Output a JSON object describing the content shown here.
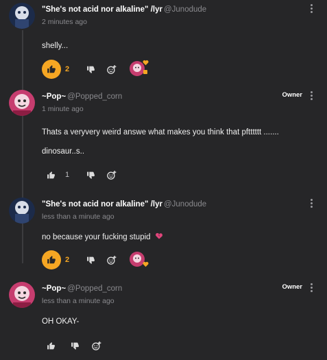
{
  "colors": {
    "background": "#262628",
    "accent": "#f5a623",
    "muted": "#8a8a8e",
    "heart": "#e0457b"
  },
  "icons": {
    "like": "thumbs-up-icon",
    "dislike": "thumbs-down-icon",
    "react": "add-reaction-icon",
    "more": "more-vertical-icon",
    "broken_heart": "broken-heart-emoji"
  },
  "comments": [
    {
      "username": "\"She's not acid nor alkaline\" /lyr",
      "handle": "@Junodude",
      "time": "2 minutes ago",
      "body": [
        "shelly..."
      ],
      "likes": "2",
      "liked": true,
      "badge": ""
    },
    {
      "username": "~Pop~",
      "handle": "@Popped_corn",
      "time": "1 minute ago",
      "body": [
        "Thats a veryvery weird answe what makes you think that pftttttt .......",
        "dinosaur..s.."
      ],
      "likes": "1",
      "liked": false,
      "badge": "Owner"
    },
    {
      "username": "\"She's not acid nor alkaline\" /lyr",
      "handle": "@Junodude",
      "time": "less than a minute ago",
      "body": [
        "no because your fucking stupid"
      ],
      "likes": "2",
      "liked": true,
      "badge": ""
    },
    {
      "username": "~Pop~",
      "handle": "@Popped_corn",
      "time": "less than a minute ago",
      "body": [
        "OH OKAY-"
      ],
      "likes": "",
      "liked": false,
      "badge": "Owner"
    }
  ]
}
